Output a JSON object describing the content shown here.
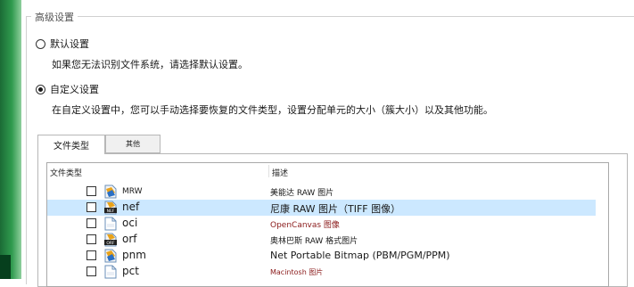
{
  "group_title": "高级设置",
  "option_default": {
    "label": "默认设置",
    "selected": false,
    "description": "如果您无法识别文件系统，请选择默认设置。"
  },
  "option_custom": {
    "label": "自定义设置",
    "selected": true,
    "description": "在自定义设置中，您可以手动选择要恢复的文件类型，设置分配单元的大小（簇大小）以及其他功能。"
  },
  "tabs": [
    {
      "label": "文件类型",
      "active": true
    },
    {
      "label": "其他",
      "active": false
    }
  ],
  "list": {
    "columns": {
      "type": "文件类型",
      "description": "描述"
    },
    "rows": [
      {
        "ext": "MRW",
        "icon": "mrw-file-icon",
        "description": "美能达 RAW 图片",
        "checked": false,
        "selected": false
      },
      {
        "ext": "nef",
        "icon": "nef-file-icon",
        "icon_badge": "NEF",
        "description": "尼康 RAW 图片（TIFF 图像）",
        "checked": false,
        "selected": true
      },
      {
        "ext": "oci",
        "icon": "blank-file-icon",
        "description": "OpenCanvas 图像",
        "checked": false,
        "selected": false
      },
      {
        "ext": "orf",
        "icon": "orf-file-icon",
        "icon_badge": "ORF",
        "description": "奥林巴斯 RAW 格式图片",
        "checked": false,
        "selected": false
      },
      {
        "ext": "pnm",
        "icon": "image-file-icon",
        "description": "Net Portable Bitmap (PBM/PGM/PPM)",
        "checked": false,
        "selected": false
      },
      {
        "ext": "pct",
        "icon": "blank-file-icon",
        "description": "Macintosh 图片",
        "checked": false,
        "selected": false
      }
    ]
  },
  "colors": {
    "selection": "#cce8ff",
    "desktop_green": "#2f9a4e",
    "description_red": "#8a1a1a"
  }
}
